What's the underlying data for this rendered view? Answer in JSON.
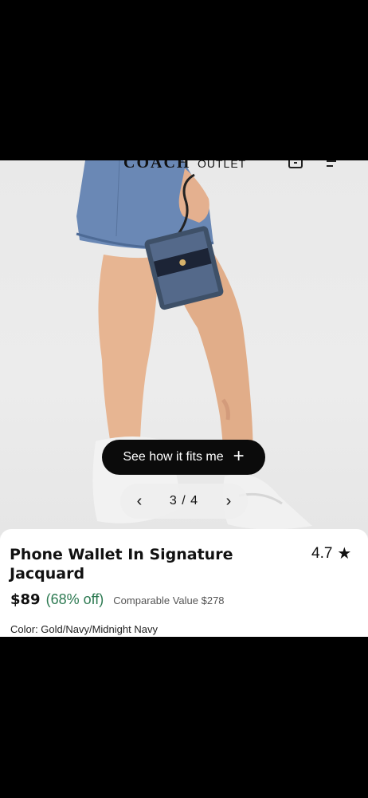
{
  "header": {
    "brand": "COACH",
    "brand_sub": "OUTLET"
  },
  "gallery": {
    "fit_button_label": "See how it fits me",
    "fit_button_icon": "plus-icon",
    "pager": {
      "current": 3,
      "total": 4,
      "label": "3 / 4"
    }
  },
  "product": {
    "title": "Phone Wallet In Signature Jacquard",
    "rating": "4.7",
    "price": "$89",
    "discount": "(68% off)",
    "comparable": "Comparable Value $278",
    "color": "Color: Gold/Navy/Midnight Navy"
  },
  "colors": {
    "discount": "#2d7a52",
    "button": "#0b0b0b"
  }
}
